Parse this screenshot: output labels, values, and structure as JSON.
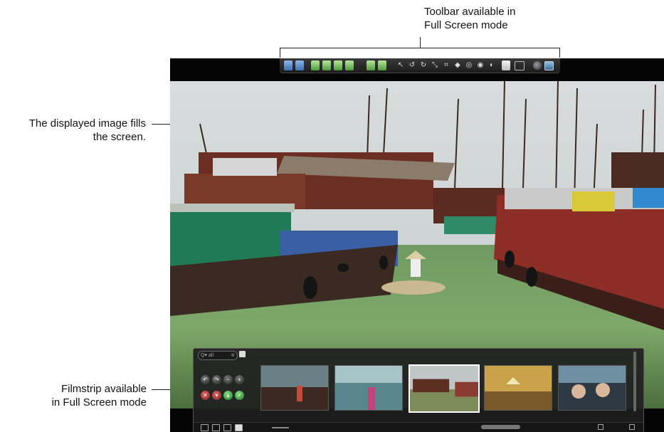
{
  "callouts": {
    "toolbar": [
      "Toolbar available in",
      "Full Screen mode"
    ],
    "image": [
      "The displayed image fills",
      "the screen."
    ],
    "filmstrip": [
      "Filmstrip available",
      "in Full Screen mode"
    ]
  },
  "toolbar": {
    "icons": [
      "view-mode-icon",
      "view-mode-icon",
      "stack-icon",
      "stack-icon",
      "stack-icon",
      "stack-icon",
      "album-icon",
      "album-icon",
      "select-tool-icon",
      "rotate-left-icon",
      "rotate-right-icon",
      "straighten-icon",
      "crop-icon",
      "spot-patch-icon",
      "red-eye-icon",
      "lift-stamp-icon",
      "stamp-icon",
      "loupe-icon",
      "hud-icon",
      "inspector-icon",
      "image-icon"
    ]
  },
  "filmstrip": {
    "search_placeholder": "all",
    "thumbnails": [
      {
        "name": "thumbnail-boy-on-boat",
        "selected": false,
        "colors": [
          "#6b7f86",
          "#3c2a22",
          "#c44a3e"
        ]
      },
      {
        "name": "thumbnail-girl-by-sea",
        "selected": false,
        "colors": [
          "#8cb4bd",
          "#5a8690",
          "#c0467c"
        ]
      },
      {
        "name": "thumbnail-harbor-boats",
        "selected": true,
        "colors": [
          "#7d8a5a",
          "#8a3c32",
          "#bfc6c6"
        ]
      },
      {
        "name": "thumbnail-street-market",
        "selected": false,
        "colors": [
          "#c9a24a",
          "#7a5a2a",
          "#f2e6b6"
        ]
      },
      {
        "name": "thumbnail-people-in-car",
        "selected": false,
        "colors": [
          "#6f8fa3",
          "#2d3a44",
          "#d9b79a"
        ]
      }
    ]
  },
  "colors": {
    "accent": "#3f6fb0"
  }
}
